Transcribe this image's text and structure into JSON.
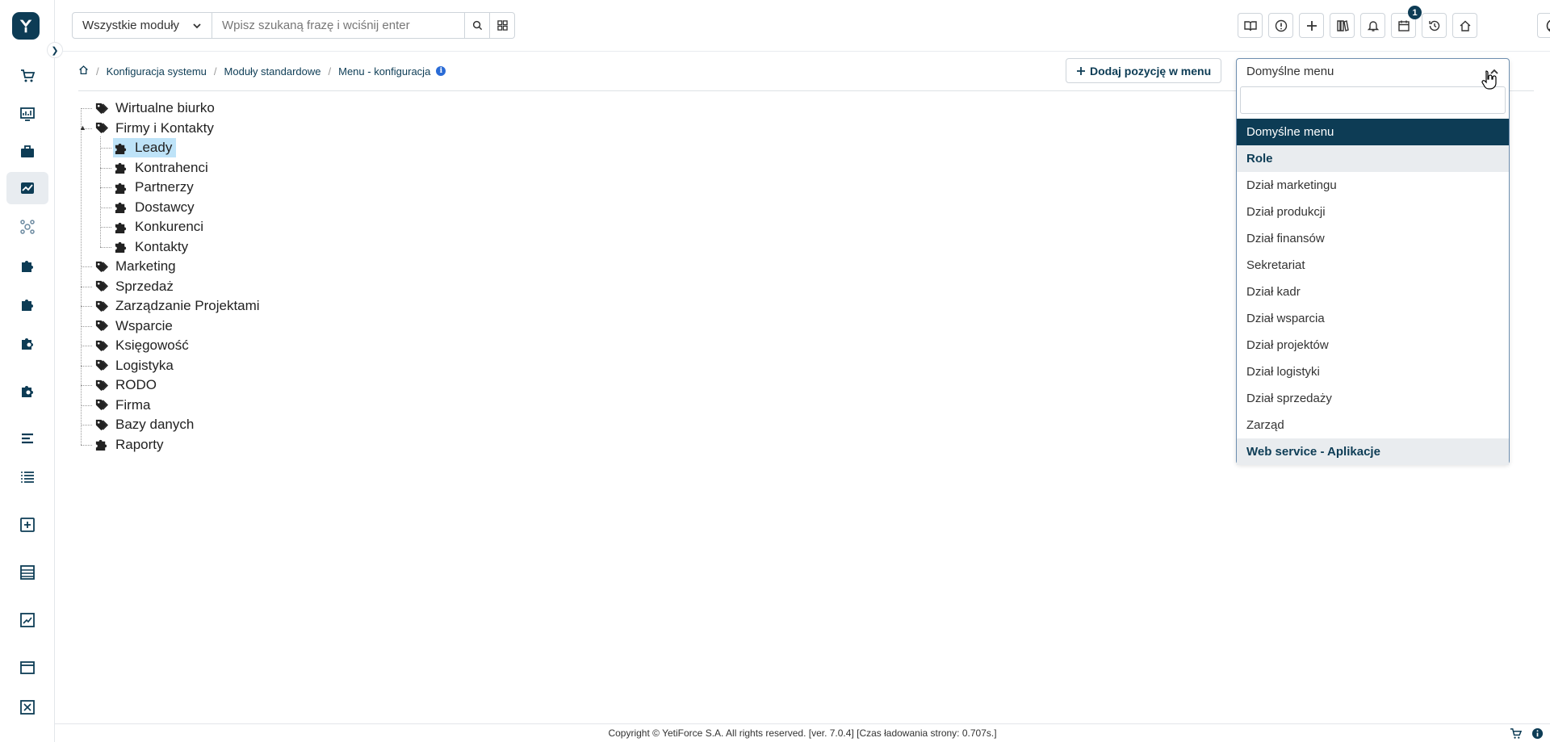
{
  "header": {
    "module_select_value": "Wszystkie moduły",
    "search_placeholder": "Wpisz szukaną frazę i wciśnij enter",
    "calendar_badge": "1"
  },
  "breadcrumb": {
    "items": [
      "Konfiguracja systemu",
      "Moduły standardowe",
      "Menu - konfiguracja"
    ]
  },
  "toolbar": {
    "add_label": "Dodaj pozycję w menu"
  },
  "tree": {
    "nodes": [
      {
        "label": "Wirtualne biurko",
        "icon": "tag-icon"
      },
      {
        "label": "Firmy i Kontakty",
        "icon": "tag-icon",
        "expanded": true,
        "children": [
          {
            "label": "Leady",
            "icon": "puzzle-icon",
            "selected": true
          },
          {
            "label": "Kontrahenci",
            "icon": "puzzle-icon"
          },
          {
            "label": "Partnerzy",
            "icon": "puzzle-icon"
          },
          {
            "label": "Dostawcy",
            "icon": "puzzle-icon"
          },
          {
            "label": "Konkurenci",
            "icon": "puzzle-icon"
          },
          {
            "label": "Kontakty",
            "icon": "puzzle-icon"
          }
        ]
      },
      {
        "label": "Marketing",
        "icon": "tag-icon"
      },
      {
        "label": "Sprzedaż",
        "icon": "tag-icon"
      },
      {
        "label": "Zarządzanie Projektami",
        "icon": "tag-icon"
      },
      {
        "label": "Wsparcie",
        "icon": "tag-icon"
      },
      {
        "label": "Księgowość",
        "icon": "tag-icon"
      },
      {
        "label": "Logistyka",
        "icon": "tag-icon"
      },
      {
        "label": "RODO",
        "icon": "tag-icon"
      },
      {
        "label": "Firma",
        "icon": "tag-icon"
      },
      {
        "label": "Bazy danych",
        "icon": "tag-icon"
      },
      {
        "label": "Raporty",
        "icon": "puzzle-icon"
      }
    ]
  },
  "menu_select": {
    "selected": "Domyślne menu",
    "options": [
      {
        "label": "Domyślne menu",
        "type": "highlight"
      },
      {
        "label": "Role",
        "type": "group"
      },
      {
        "label": "Dział marketingu",
        "type": "option"
      },
      {
        "label": "Dział produkcji",
        "type": "option"
      },
      {
        "label": "Dział finansów",
        "type": "option"
      },
      {
        "label": "Sekretariat",
        "type": "option"
      },
      {
        "label": "Dział kadr",
        "type": "option"
      },
      {
        "label": "Dział wsparcia",
        "type": "option"
      },
      {
        "label": "Dział projektów",
        "type": "option"
      },
      {
        "label": "Dział logistyki",
        "type": "option"
      },
      {
        "label": "Dział sprzedaży",
        "type": "option"
      },
      {
        "label": "Zarząd",
        "type": "option"
      },
      {
        "label": "Web service - Aplikacje",
        "type": "group"
      }
    ]
  },
  "footer": {
    "text": "Copyright © YetiForce S.A. All rights reserved. [ver. 7.0.4] [Czas ładowania strony: 0.707s.]"
  },
  "colors": {
    "brand": "#0d3c55",
    "selected_node": "#bee3f8",
    "group_bg": "#e9ecef"
  }
}
